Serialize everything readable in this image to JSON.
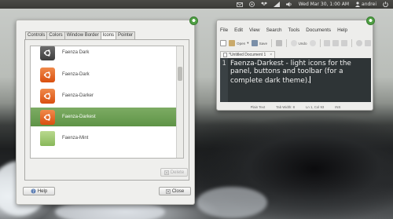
{
  "panel": {
    "datetime": "Wed Mar 30,  1:00 AM",
    "username": "andrei"
  },
  "appearance": {
    "tabs": [
      "Controls",
      "Colors",
      "Window Border",
      "Icons",
      "Pointer"
    ],
    "active_tab": "Icons",
    "themes": [
      {
        "name": "Faenza Dark",
        "selected": false
      },
      {
        "name": "Faenza-Dark",
        "selected": false
      },
      {
        "name": "Faenza-Darker",
        "selected": false
      },
      {
        "name": "Faenza-Darkest",
        "selected": true
      },
      {
        "name": "Faenza-Mint",
        "selected": false
      }
    ],
    "delete_label": "Delete",
    "help_label": "Help",
    "close_label": "Close"
  },
  "editor": {
    "menu": [
      "File",
      "Edit",
      "View",
      "Search",
      "Tools",
      "Documents",
      "Help"
    ],
    "toolbar": {
      "open": "Open",
      "save": "Save",
      "undo": "Undo"
    },
    "doc_tab": "*Untitled Document 1",
    "line_number": "1",
    "content": "Faenza-Darkest - light icons for the panel, buttons and toolbar (for a complete dark theme).",
    "status": {
      "mode": "Plain Text",
      "tab_width": "Tab Width: 8",
      "position": "Ln 1, Col 93",
      "ins": "INS"
    }
  },
  "colors": {
    "selection": "#6a9e50",
    "editor_bg": "#2e3436",
    "ubuntu_orange": "#e05a1a"
  }
}
